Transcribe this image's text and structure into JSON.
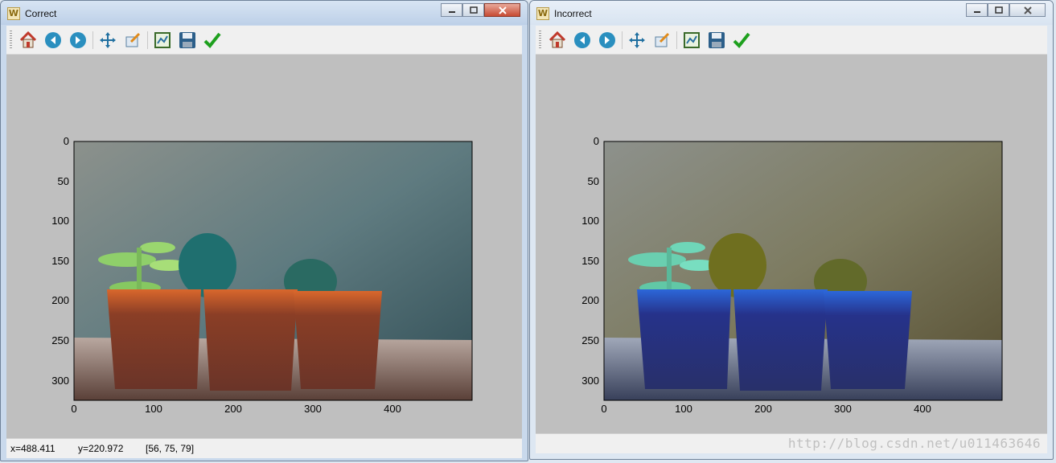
{
  "windows": [
    {
      "id": "left",
      "title": "Correct",
      "status": {
        "x": "x=488.411",
        "y": "y=220.972",
        "rgb": "[56, 75, 79]"
      },
      "image_style": "correct"
    },
    {
      "id": "right",
      "title": "Incorrect",
      "status": {
        "watermark": "http://blog.csdn.net/u011463646"
      },
      "image_style": "incorrect"
    }
  ],
  "toolbar": {
    "icons": [
      "home-icon",
      "back-icon",
      "forward-icon",
      "pan-icon",
      "zoom-icon",
      "configure-subplots-icon",
      "save-icon",
      "edit-check-icon"
    ]
  },
  "axes": {
    "x_ticks": [
      "0",
      "100",
      "200",
      "300",
      "400"
    ],
    "y_ticks": [
      "0",
      "50",
      "100",
      "150",
      "200",
      "250",
      "300"
    ]
  },
  "colors": {
    "figure_bg": "#bfbfbf",
    "correct_pots": "#b4532e",
    "incorrect_pots": "#3a4fb0"
  }
}
